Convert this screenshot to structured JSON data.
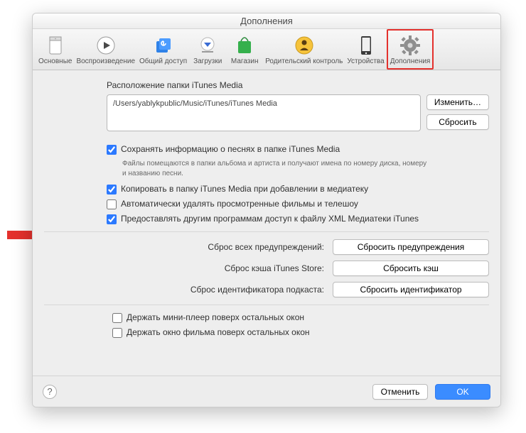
{
  "window": {
    "title": "Дополнения"
  },
  "toolbar": {
    "items": [
      {
        "id": "general",
        "label": "Основные"
      },
      {
        "id": "playback",
        "label": "Воспроизведение"
      },
      {
        "id": "sharing",
        "label": "Общий доступ"
      },
      {
        "id": "downloads",
        "label": "Загрузки"
      },
      {
        "id": "store",
        "label": "Магазин"
      },
      {
        "id": "parental",
        "label": "Родительский контроль"
      },
      {
        "id": "devices",
        "label": "Устройства"
      },
      {
        "id": "advanced",
        "label": "Дополнения"
      }
    ]
  },
  "location": {
    "label": "Расположение папки iTunes Media",
    "path": "/Users/yablykpublic/Music/iTunes/iTunes Media",
    "change_btn": "Изменить…",
    "reset_btn": "Сбросить"
  },
  "options": {
    "keep_organized": {
      "checked": true,
      "label": "Сохранять информацию о песнях в папке iTunes Media"
    },
    "keep_organized_note": "Файлы помещаются в папки альбома и артиста и получают имена по номеру диска, номеру и названию песни.",
    "copy_to_media": {
      "checked": true,
      "label": "Копировать в папку iTunes Media при добавлении в медиатеку"
    },
    "auto_delete": {
      "checked": false,
      "label": "Автоматически удалять просмотренные фильмы и телешоу"
    },
    "share_xml": {
      "checked": true,
      "label": "Предоставлять другим программам доступ к файлу XML Медиатеки iTunes"
    }
  },
  "resets": {
    "warnings": {
      "label": "Сброс всех предупреждений:",
      "btn": "Сбросить предупреждения"
    },
    "cache": {
      "label": "Сброс кэша iTunes Store:",
      "btn": "Сбросить кэш"
    },
    "podcast": {
      "label": "Сброс идентификатора подкаста:",
      "btn": "Сбросить идентификатор"
    }
  },
  "keep_on_top": {
    "miniplayer": {
      "checked": false,
      "label": "Держать мини-плеер поверх остальных окон"
    },
    "movie": {
      "checked": false,
      "label": "Держать окно фильма поверх остальных окон"
    }
  },
  "footer": {
    "help": "?",
    "cancel": "Отменить",
    "ok": "OK"
  }
}
